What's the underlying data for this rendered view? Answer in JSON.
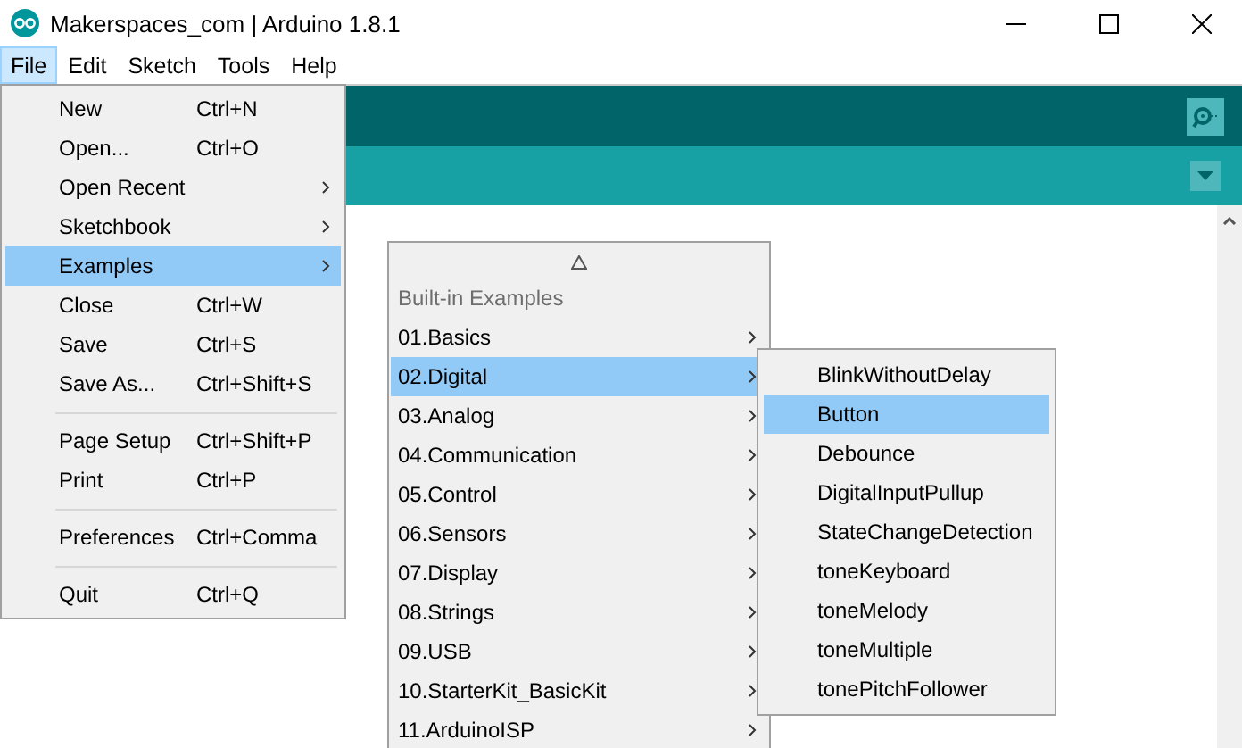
{
  "window": {
    "title": "Makerspaces_com | Arduino 1.8.1"
  },
  "menubar": [
    {
      "label": "File",
      "selected": true
    },
    {
      "label": "Edit",
      "selected": false
    },
    {
      "label": "Sketch",
      "selected": false
    },
    {
      "label": "Tools",
      "selected": false
    },
    {
      "label": "Help",
      "selected": false
    }
  ],
  "file_menu": [
    {
      "kind": "item",
      "label": "New",
      "shortcut": "Ctrl+N",
      "submenu": false,
      "selected": false
    },
    {
      "kind": "item",
      "label": "Open...",
      "shortcut": "Ctrl+O",
      "submenu": false,
      "selected": false
    },
    {
      "kind": "item",
      "label": "Open Recent",
      "submenu": true,
      "selected": false
    },
    {
      "kind": "item",
      "label": "Sketchbook",
      "submenu": true,
      "selected": false
    },
    {
      "kind": "item",
      "label": "Examples",
      "submenu": true,
      "selected": true
    },
    {
      "kind": "item",
      "label": "Close",
      "shortcut": "Ctrl+W",
      "submenu": false,
      "selected": false
    },
    {
      "kind": "item",
      "label": "Save",
      "shortcut": "Ctrl+S",
      "submenu": false,
      "selected": false
    },
    {
      "kind": "item",
      "label": "Save As...",
      "shortcut": "Ctrl+Shift+S",
      "submenu": false,
      "selected": false
    },
    {
      "kind": "separator"
    },
    {
      "kind": "item",
      "label": "Page Setup",
      "shortcut": "Ctrl+Shift+P",
      "submenu": false,
      "selected": false
    },
    {
      "kind": "item",
      "label": "Print",
      "shortcut": "Ctrl+P",
      "submenu": false,
      "selected": false
    },
    {
      "kind": "separator"
    },
    {
      "kind": "item",
      "label": "Preferences",
      "shortcut": "Ctrl+Comma",
      "submenu": false,
      "selected": false
    },
    {
      "kind": "separator"
    },
    {
      "kind": "item",
      "label": "Quit",
      "shortcut": "Ctrl+Q",
      "submenu": false,
      "selected": false
    }
  ],
  "examples_menu": {
    "header": "Built-in Examples",
    "items": [
      {
        "label": "01.Basics",
        "selected": false
      },
      {
        "label": "02.Digital",
        "selected": true
      },
      {
        "label": "03.Analog",
        "selected": false
      },
      {
        "label": "04.Communication",
        "selected": false
      },
      {
        "label": "05.Control",
        "selected": false
      },
      {
        "label": "06.Sensors",
        "selected": false
      },
      {
        "label": "07.Display",
        "selected": false
      },
      {
        "label": "08.Strings",
        "selected": false
      },
      {
        "label": "09.USB",
        "selected": false
      },
      {
        "label": "10.StarterKit_BasicKit",
        "selected": false
      },
      {
        "label": "11.ArduinoISP",
        "selected": false
      }
    ]
  },
  "digital_menu": [
    {
      "label": "BlinkWithoutDelay",
      "selected": false
    },
    {
      "label": "Button",
      "selected": true
    },
    {
      "label": "Debounce",
      "selected": false
    },
    {
      "label": "DigitalInputPullup",
      "selected": false
    },
    {
      "label": "StateChangeDetection",
      "selected": false
    },
    {
      "label": "toneKeyboard",
      "selected": false
    },
    {
      "label": "toneMelody",
      "selected": false
    },
    {
      "label": "toneMultiple",
      "selected": false
    },
    {
      "label": "tonePitchFollower",
      "selected": false
    }
  ]
}
